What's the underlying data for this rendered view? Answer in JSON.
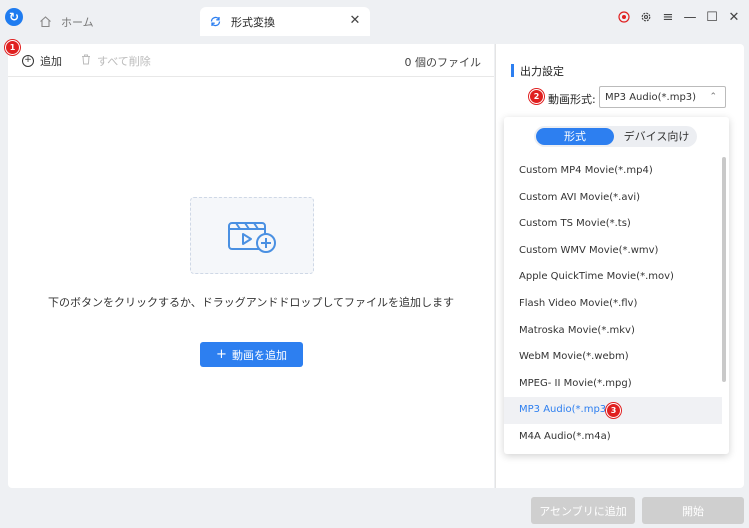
{
  "app": {
    "logo_glyph": "↻"
  },
  "tabs": [
    {
      "label": "ホーム",
      "icon": "home-icon"
    },
    {
      "label": "形式変換",
      "icon": "refresh-icon",
      "close": "✕"
    }
  ],
  "window_controls": {
    "record": "record-icon",
    "settings": "gear-icon",
    "menu": "≡",
    "minimize": "—",
    "maximize": "☐",
    "close": "✕"
  },
  "toolbar": {
    "add_label": "追加",
    "delete_all_label": "すべて削除",
    "file_count": "0 個のファイル"
  },
  "dropzone": {
    "hint": "下のボタンをクリックするか、ドラッグアンドドロップしてファイルを追加します",
    "add_video_label": "動画を追加",
    "add_video_plus": "+"
  },
  "badges": {
    "one": "1",
    "two": "2",
    "three": "3"
  },
  "output": {
    "section_title": "出力設定",
    "format_label": "動画形式:",
    "selected_format": "MP3 Audio(*.mp3)",
    "chevron": "⌃"
  },
  "dropdown": {
    "seg_format": "形式",
    "seg_device": "デバイス向け",
    "options": [
      "Custom MP4 Movie(*.mp4)",
      "Custom AVI Movie(*.avi)",
      "Custom TS Movie(*.ts)",
      "Custom WMV Movie(*.wmv)",
      "Apple QuickTime Movie(*.mov)",
      "Flash Video Movie(*.flv)",
      "Matroska Movie(*.mkv)",
      "WebM Movie(*.webm)",
      "MPEG- II Movie(*.mpg)",
      "MP3 Audio(*.mp3)",
      "M4A Audio(*.m4a)"
    ],
    "selected_index": 9
  },
  "bottom": {
    "add_assembly": "アセンブリに追加",
    "start": "開始"
  },
  "colors": {
    "accent": "#2d7ff0",
    "badge": "#e02020",
    "disabled": "#cfcfcf"
  }
}
